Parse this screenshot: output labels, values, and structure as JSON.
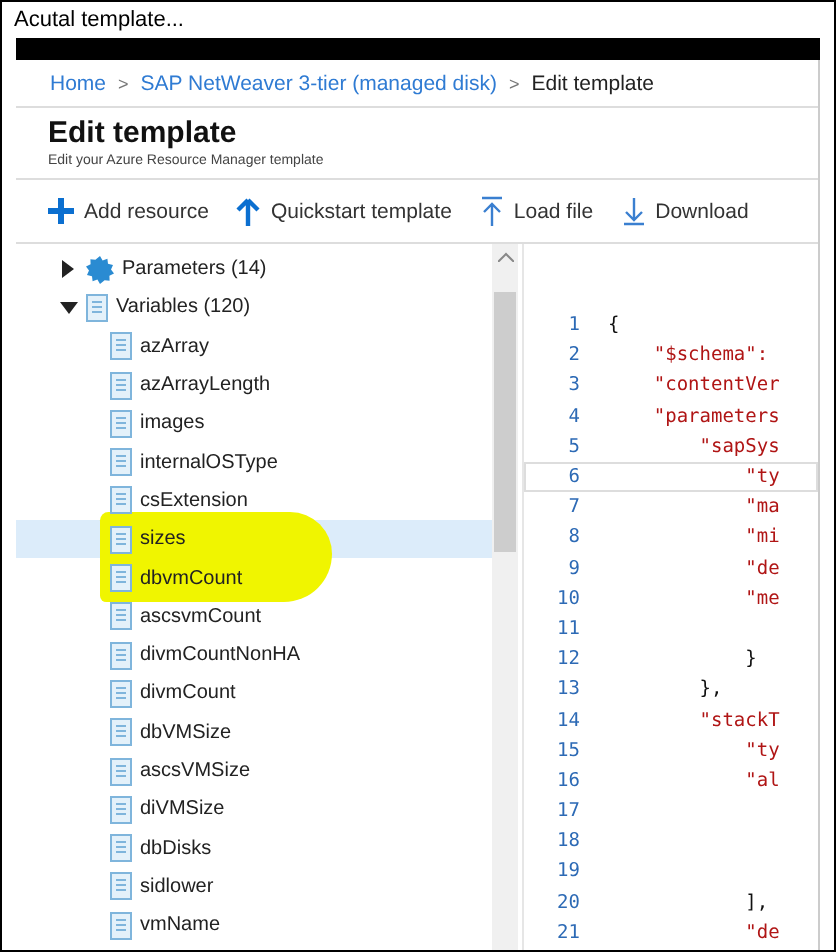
{
  "caption": "Acutal template...",
  "breadcrumb": [
    {
      "label": "Home",
      "link": true
    },
    {
      "separator": ">",
      "label": "SAP NetWeaver 3-tier (managed disk)",
      "link": true
    },
    {
      "separator": ">",
      "label": "Edit template",
      "link": false
    }
  ],
  "page": {
    "title": "Edit template",
    "subtitle": "Edit your Azure Resource Manager template"
  },
  "toolbar": [
    {
      "label": "Add resource",
      "kind": "add"
    },
    {
      "label": "Quickstart template",
      "kind": "up"
    },
    {
      "label": "Load file",
      "kind": "upload"
    },
    {
      "label": "Download",
      "kind": "download"
    }
  ],
  "tree": [
    {
      "label": "Parameters (14)",
      "kind": "gear",
      "expanded": false
    },
    {
      "label": "Variables (120)",
      "kind": "doc",
      "expanded": true,
      "children": [
        {
          "label": "azArray",
          "selected": false
        },
        {
          "label": "azArrayLength",
          "selected": false
        },
        {
          "label": "images",
          "selected": false
        },
        {
          "label": "internalOSType",
          "selected": false
        },
        {
          "label": "csExtension",
          "selected": false
        },
        {
          "label": "sizes",
          "selected": true
        },
        {
          "label": "dbvmCount",
          "selected": false
        },
        {
          "label": "ascsvmCount",
          "selected": false
        },
        {
          "label": "divmCountNonHA",
          "selected": false
        },
        {
          "label": "divmCount",
          "selected": false
        },
        {
          "label": "dbVMSize",
          "selected": false
        },
        {
          "label": "ascsVMSize",
          "selected": false
        },
        {
          "label": "diVMSize",
          "selected": false
        },
        {
          "label": "dbDisks",
          "selected": false
        },
        {
          "label": "sidlower",
          "selected": false
        },
        {
          "label": "vmName",
          "selected": false
        }
      ]
    }
  ],
  "editor": {
    "lines": [
      {
        "number": "1",
        "code": "{"
      },
      {
        "number": "2",
        "code": "    \"$schema\":"
      },
      {
        "number": "3",
        "code": "    \"contentVer"
      },
      {
        "number": "4",
        "code": "    \"parameters"
      },
      {
        "number": "5",
        "code": "        \"sapSys"
      },
      {
        "number": "6",
        "code": "            \"ty",
        "current": true
      },
      {
        "number": "7",
        "code": "            \"ma"
      },
      {
        "number": "8",
        "code": "            \"mi"
      },
      {
        "number": "9",
        "code": "            \"de"
      },
      {
        "number": "10",
        "code": "            \"me"
      },
      {
        "number": "11"
      },
      {
        "number": "12",
        "code": "            }"
      },
      {
        "number": "13",
        "code": "        },"
      },
      {
        "number": "14",
        "code": "        \"stackT"
      },
      {
        "number": "15",
        "code": "            \"ty"
      },
      {
        "number": "16",
        "code": "            \"al"
      },
      {
        "number": "17"
      },
      {
        "number": "18"
      },
      {
        "number": "19"
      },
      {
        "number": "20",
        "code": "            ],"
      },
      {
        "number": "21",
        "code": "            \"de"
      }
    ]
  }
}
